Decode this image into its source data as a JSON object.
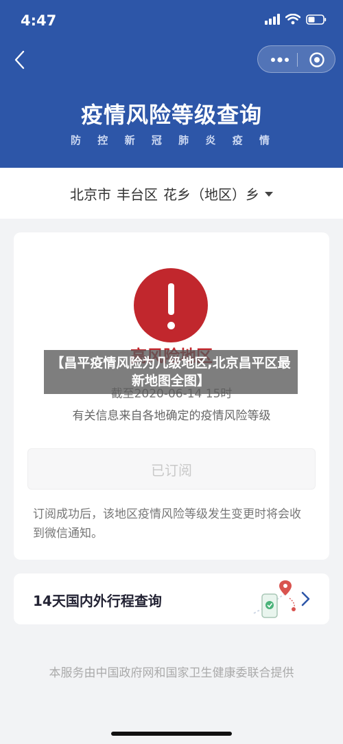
{
  "status_bar": {
    "time": "4:47"
  },
  "header": {
    "title": "疫情风险等级查询",
    "subtitle_chars": [
      "防",
      "控",
      "新",
      "冠",
      "肺",
      "炎",
      "疫",
      "情"
    ]
  },
  "location": {
    "city": "北京市",
    "district": "丰台区",
    "area": "花乡（地区）乡"
  },
  "risk_card": {
    "level_label": "高风险地区",
    "as_of": "截至2020-06-14 15时",
    "source_note": "有关信息来自各地确定的疫情风险等级",
    "subscribe_label": "已订阅",
    "subscribe_note": "订阅成功后，该地区疫情风险等级发生变更时将会收到微信通知。",
    "risk_color": "#c1272d"
  },
  "itinerary": {
    "label": "14天国内外行程查询"
  },
  "footer": {
    "text": "本服务由中国政府网和国家卫生健康委联合提供"
  },
  "overlay": {
    "text": "【昌平疫情风险为几级地区,北京昌平区最新地图全图】"
  },
  "colors": {
    "header_blue": "#2d56a8"
  }
}
